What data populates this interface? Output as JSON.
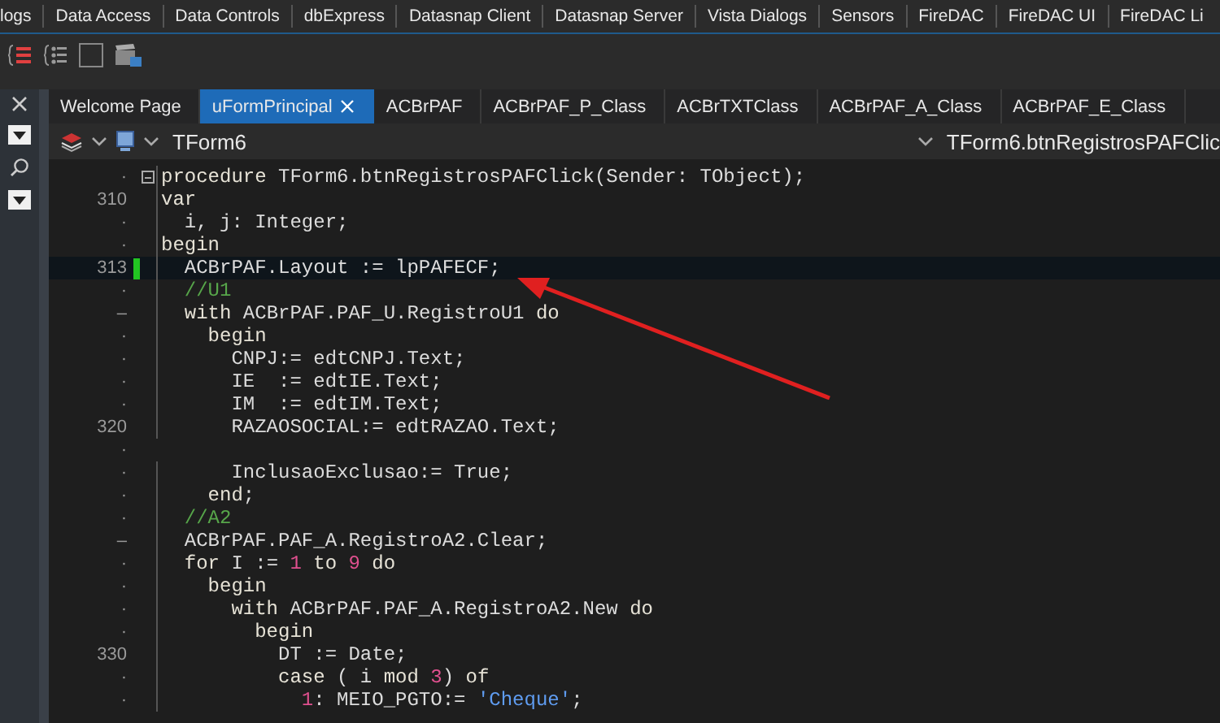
{
  "palette_tabs": [
    "logs",
    "Data Access",
    "Data Controls",
    "dbExpress",
    "Datasnap Client",
    "Datasnap Server",
    "Vista Dialogs",
    "Sensors",
    "FireDAC",
    "FireDAC UI",
    "FireDAC Li"
  ],
  "editor_tabs": [
    {
      "label": "Welcome Page",
      "selected": false
    },
    {
      "label": "uFormPrincipal",
      "selected": true
    },
    {
      "label": "ACBrPAF",
      "selected": false
    },
    {
      "label": "ACBrPAF_P_Class",
      "selected": false
    },
    {
      "label": "ACBrTXTClass",
      "selected": false
    },
    {
      "label": "ACBrPAF_A_Class",
      "selected": false
    },
    {
      "label": "ACBrPAF_E_Class",
      "selected": false
    }
  ],
  "editor_header": {
    "class_selector": "TForm6",
    "method_selector": "TForm6.btnRegistrosPAFClic"
  },
  "code_lines": [
    {
      "gutter": "·",
      "fold": true,
      "modified": false,
      "current": false,
      "segments": [
        {
          "kind": "keyword",
          "text": "procedure"
        },
        {
          "kind": "plain",
          "text": " TForm6.btnRegistrosPAFClick(Sender: TObject);"
        }
      ]
    },
    {
      "gutter": "310",
      "fold": false,
      "modified": false,
      "current": false,
      "segments": [
        {
          "kind": "keyword",
          "text": "var"
        }
      ]
    },
    {
      "gutter": "·",
      "fold": false,
      "modified": false,
      "current": false,
      "segments": [
        {
          "kind": "plain",
          "text": "  i, j: Integer;"
        }
      ]
    },
    {
      "gutter": "·",
      "fold": false,
      "modified": false,
      "current": false,
      "segments": [
        {
          "kind": "keyword",
          "text": "begin"
        }
      ]
    },
    {
      "gutter": "313",
      "fold": false,
      "modified": true,
      "current": true,
      "segments": [
        {
          "kind": "plain",
          "text": "  ACBrPAF.Layout := lpPAFECF;"
        }
      ]
    },
    {
      "gutter": "·",
      "fold": false,
      "modified": false,
      "current": false,
      "segments": [
        {
          "kind": "comment",
          "text": "  //U1"
        }
      ]
    },
    {
      "gutter": "–",
      "fold": false,
      "modified": false,
      "current": false,
      "segments": [
        {
          "kind": "keyword",
          "text": "  with"
        },
        {
          "kind": "plain",
          "text": " ACBrPAF.PAF_U.RegistroU1 "
        },
        {
          "kind": "keyword",
          "text": "do"
        }
      ]
    },
    {
      "gutter": "·",
      "fold": false,
      "modified": false,
      "current": false,
      "segments": [
        {
          "kind": "keyword",
          "text": "    begin"
        }
      ]
    },
    {
      "gutter": "·",
      "fold": false,
      "modified": false,
      "current": false,
      "segments": [
        {
          "kind": "plain",
          "text": "      CNPJ:= edtCNPJ.Text;"
        }
      ]
    },
    {
      "gutter": "·",
      "fold": false,
      "modified": false,
      "current": false,
      "segments": [
        {
          "kind": "plain",
          "text": "      IE  := edtIE.Text;"
        }
      ]
    },
    {
      "gutter": "·",
      "fold": false,
      "modified": false,
      "current": false,
      "segments": [
        {
          "kind": "plain",
          "text": "      IM  := edtIM.Text;"
        }
      ]
    },
    {
      "gutter": "320",
      "fold": false,
      "modified": false,
      "current": false,
      "segments": [
        {
          "kind": "plain",
          "text": "      RAZAOSOCIAL:= edtRAZAO.Text;"
        }
      ]
    },
    {
      "gutter": "·",
      "fold": false,
      "modified": false,
      "current": false
    },
    {
      "gutter": "·",
      "fold": false,
      "modified": false,
      "current": false,
      "segments": [
        {
          "kind": "plain",
          "text": "      InclusaoExclusao:= True;"
        }
      ]
    },
    {
      "gutter": "·",
      "fold": false,
      "modified": false,
      "current": false,
      "segments": [
        {
          "kind": "keyword",
          "text": "    end"
        },
        {
          "kind": "plain",
          "text": ";"
        }
      ]
    },
    {
      "gutter": "·",
      "fold": false,
      "modified": false,
      "current": false,
      "segments": [
        {
          "kind": "comment",
          "text": "  //A2"
        }
      ]
    },
    {
      "gutter": "–",
      "fold": false,
      "modified": false,
      "current": false,
      "segments": [
        {
          "kind": "plain",
          "text": "  ACBrPAF.PAF_A.RegistroA2.Clear;"
        }
      ]
    },
    {
      "gutter": "·",
      "fold": false,
      "modified": false,
      "current": false,
      "segments": [
        {
          "kind": "keyword",
          "text": "  for"
        },
        {
          "kind": "plain",
          "text": " I := "
        },
        {
          "kind": "number",
          "text": "1"
        },
        {
          "kind": "keyword",
          "text": " to "
        },
        {
          "kind": "number",
          "text": "9"
        },
        {
          "kind": "keyword",
          "text": " do"
        }
      ]
    },
    {
      "gutter": "·",
      "fold": false,
      "modified": false,
      "current": false,
      "segments": [
        {
          "kind": "keyword",
          "text": "    begin"
        }
      ]
    },
    {
      "gutter": "·",
      "fold": false,
      "modified": false,
      "current": false,
      "segments": [
        {
          "kind": "keyword",
          "text": "      with"
        },
        {
          "kind": "plain",
          "text": " ACBrPAF.PAF_A.RegistroA2.New "
        },
        {
          "kind": "keyword",
          "text": "do"
        }
      ]
    },
    {
      "gutter": "·",
      "fold": false,
      "modified": false,
      "current": false,
      "segments": [
        {
          "kind": "keyword",
          "text": "        begin"
        }
      ]
    },
    {
      "gutter": "330",
      "fold": false,
      "modified": false,
      "current": false,
      "segments": [
        {
          "kind": "plain",
          "text": "          DT := Date;"
        }
      ]
    },
    {
      "gutter": "·",
      "fold": false,
      "modified": false,
      "current": false,
      "segments": [
        {
          "kind": "keyword",
          "text": "          case"
        },
        {
          "kind": "plain",
          "text": " ( i "
        },
        {
          "kind": "keyword",
          "text": "mod "
        },
        {
          "kind": "number",
          "text": "3"
        },
        {
          "kind": "plain",
          "text": ") "
        },
        {
          "kind": "keyword",
          "text": "of"
        }
      ]
    },
    {
      "gutter": "·",
      "fold": false,
      "modified": false,
      "current": false,
      "segments": [
        {
          "kind": "number",
          "text": "            1"
        },
        {
          "kind": "plain",
          "text": ": MEIO_PGTO:= "
        },
        {
          "kind": "string",
          "text": "'Cheque'"
        },
        {
          "kind": "plain",
          "text": ";"
        }
      ]
    }
  ]
}
